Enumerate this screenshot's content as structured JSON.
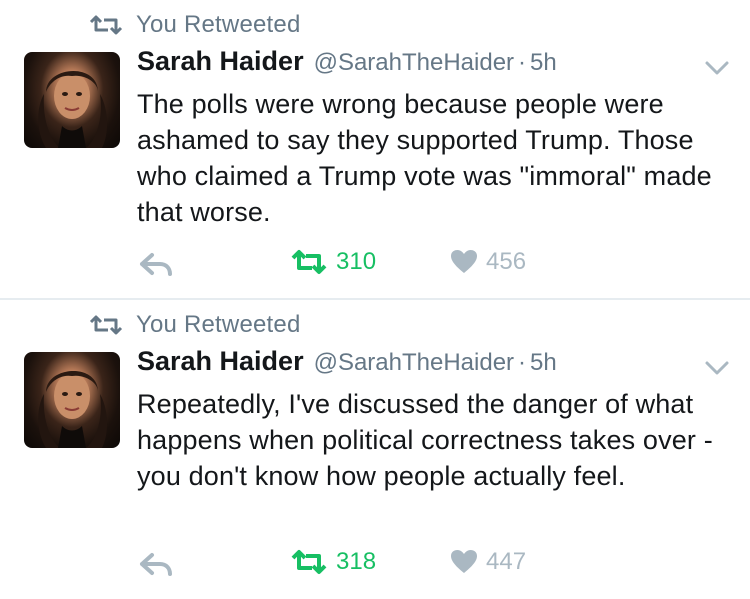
{
  "colors": {
    "text_primary": "#14171a",
    "text_secondary": "#657786",
    "retweet_green": "#17bf63",
    "icon_gray": "#aab8c2",
    "divider": "#e6ecf0"
  },
  "tweets": [
    {
      "retweet_context": "You Retweeted",
      "author_name": "Sarah Haider",
      "handle": "@SarahTheHaider",
      "separator": "·",
      "time": "5h",
      "text": "The polls were wrong because people were ashamed to say they supported Trump. Those who claimed a Trump vote was \"immoral\" made that worse.",
      "retweets": "310",
      "likes": "456",
      "retweeted": true,
      "liked": false,
      "icons": {
        "reply": "reply-icon",
        "retweet": "retweet-icon",
        "like": "heart-icon",
        "menu": "chevron-down-icon"
      }
    },
    {
      "retweet_context": "You Retweeted",
      "author_name": "Sarah Haider",
      "handle": "@SarahTheHaider",
      "separator": "·",
      "time": "5h",
      "text": "Repeatedly, I've discussed the danger of what happens when political correctness takes over - you don't know how people actually feel.",
      "retweets": "318",
      "likes": "447",
      "retweeted": true,
      "liked": false,
      "icons": {
        "reply": "reply-icon",
        "retweet": "retweet-icon",
        "like": "heart-icon",
        "menu": "chevron-down-icon"
      }
    }
  ]
}
